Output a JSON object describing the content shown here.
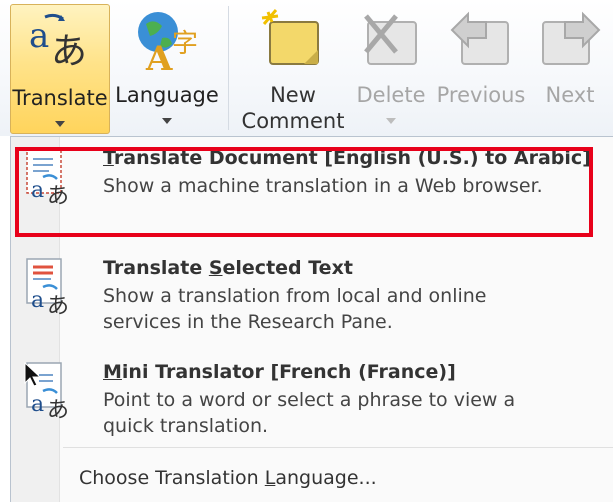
{
  "ribbon": {
    "translate_label": "Translate",
    "language_label": "Language",
    "new_comment_line1": "New",
    "new_comment_line2": "Comment",
    "delete_label": "Delete",
    "previous_label": "Previous",
    "next_label": "Next"
  },
  "menu": {
    "translate_document": {
      "title_rest": "ranslate Document [English (U.S.) to Arabic]",
      "title_access": "T",
      "description": "Show a machine translation in a Web browser."
    },
    "translate_selected": {
      "title_pre": "Translate ",
      "title_access": "S",
      "title_rest": "elected Text",
      "description": "Show a translation from local and online services in the Research Pane."
    },
    "mini_translator": {
      "title_access": "M",
      "title_rest": "ini Translator [French (France)]",
      "description": "Point to a word or select a phrase to view a quick translation."
    },
    "choose_language": {
      "pre": "Choose Translation ",
      "access": "L",
      "rest": "anguage..."
    }
  },
  "colors": {
    "highlight_border": "#e8001a",
    "translate_button_bg": "#ffd45c",
    "disabled_text": "#a6a6a6"
  },
  "icons": [
    "translate-icon",
    "language-icon",
    "new-comment-icon",
    "delete-comment-icon",
    "previous-comment-icon",
    "next-comment-icon",
    "translate-document-icon",
    "translate-selected-text-icon",
    "mini-translator-icon"
  ]
}
